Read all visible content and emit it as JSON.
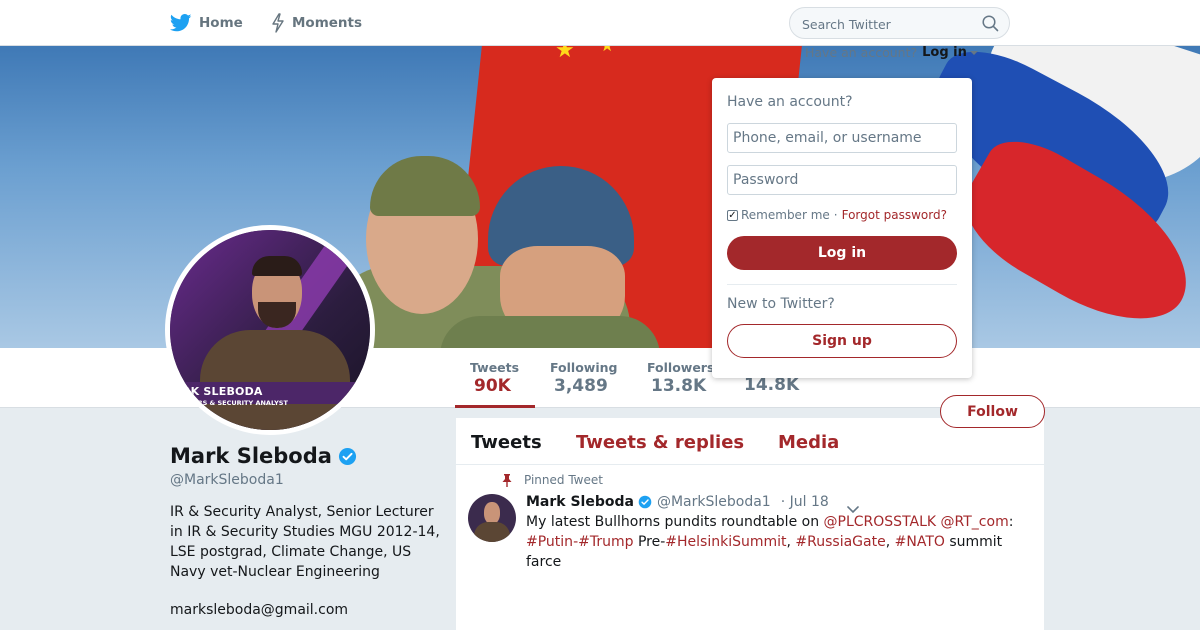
{
  "nav": {
    "home_label": "Home",
    "moments_label": "Moments",
    "search_placeholder": "Search Twitter",
    "have_account_text": "Have an account?",
    "login_link": "Log in"
  },
  "dropdown": {
    "title": "Have an account?",
    "username_placeholder": "Phone, email, or username",
    "password_placeholder": "Password",
    "remember_label": "Remember me",
    "separator": "·",
    "forgot_link": "Forgot password?",
    "login_button": "Log in",
    "new_text": "New to Twitter?",
    "signup_button": "Sign up"
  },
  "avatar": {
    "lower_third_name": "RK SLEBODA",
    "lower_third_role": "FFAIRS & SECURITY ANALYST"
  },
  "stats": {
    "tweets_label": "Tweets",
    "tweets_value": "90K",
    "following_label": "Following",
    "following_value": "3,489",
    "followers_label": "Followers",
    "followers_value": "13.8K",
    "likes_value": "14.8K"
  },
  "follow_button": "Follow",
  "profile": {
    "name": "Mark Sleboda",
    "handle": "@MarkSleboda1",
    "bio": "IR & Security Analyst, Senior Lecturer in IR & Security Studies MGU 2012-14, LSE postgrad, Climate Change, US Navy vet-Nuclear Engineering",
    "email": "marksleboda@gmail.com"
  },
  "timeline": {
    "tabs": [
      "Tweets",
      "Tweets & replies",
      "Media"
    ],
    "pinned_label": "Pinned Tweet",
    "tweet": {
      "author": "Mark Sleboda",
      "handle": "@MarkSleboda1",
      "date": "· Jul 18",
      "text_1": "My latest Bullhorns pundits roundtable on ",
      "mention_1": "@PLCROSSTALK",
      "space": " ",
      "mention_2": "@RT_com",
      "colon": ":",
      "hashtag_1": "#Putin",
      "dash": "-",
      "hashtag_2": "#Trump",
      "pre": " Pre-",
      "hashtag_3": "#HelsinkiSummit",
      "comma_1": ", ",
      "hashtag_4": "#RussiaGate",
      "comma_2": ", ",
      "hashtag_5": "#NATO",
      "text_end": " summit farce"
    }
  },
  "colors": {
    "accent": "#a3282b",
    "verified": "#1da1f2",
    "twitter_blue": "#1da1f2",
    "muted": "#657786"
  }
}
